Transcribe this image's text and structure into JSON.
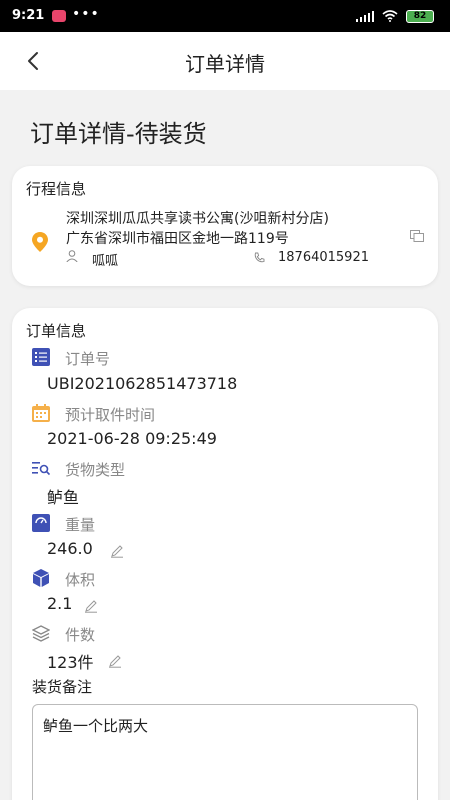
{
  "status_bar": {
    "time": "9:21",
    "dots": "•••",
    "battery": "82"
  },
  "header": {
    "title": "订单详情"
  },
  "page_title": "订单详情-待装货",
  "trip": {
    "heading": "行程信息",
    "address_line1": "深圳深圳瓜瓜共享读书公寓(沙咀新村分店)",
    "address_line2": "广东省深圳市福田区金地一路119号",
    "contact_name": "呱呱",
    "contact_phone": "18764015921"
  },
  "order": {
    "heading": "订单信息",
    "order_no_label": "订单号",
    "order_no": "UBI2021062851473718",
    "pickup_time_label": "预计取件时间",
    "pickup_time": "2021-06-28 09:25:49",
    "cargo_type_label": "货物类型",
    "cargo_type": "鲈鱼",
    "weight_label": "重量",
    "weight": "246.0",
    "volume_label": "体积",
    "volume": "2.1",
    "count_label": "件数",
    "count": "123件",
    "remark_label": "装货备注",
    "remark": "鲈鱼一个比两大"
  },
  "colors": {
    "accent_blue": "#3f51b5",
    "calendar_orange": "#f5b04a",
    "location_orange": "#f5a623"
  }
}
